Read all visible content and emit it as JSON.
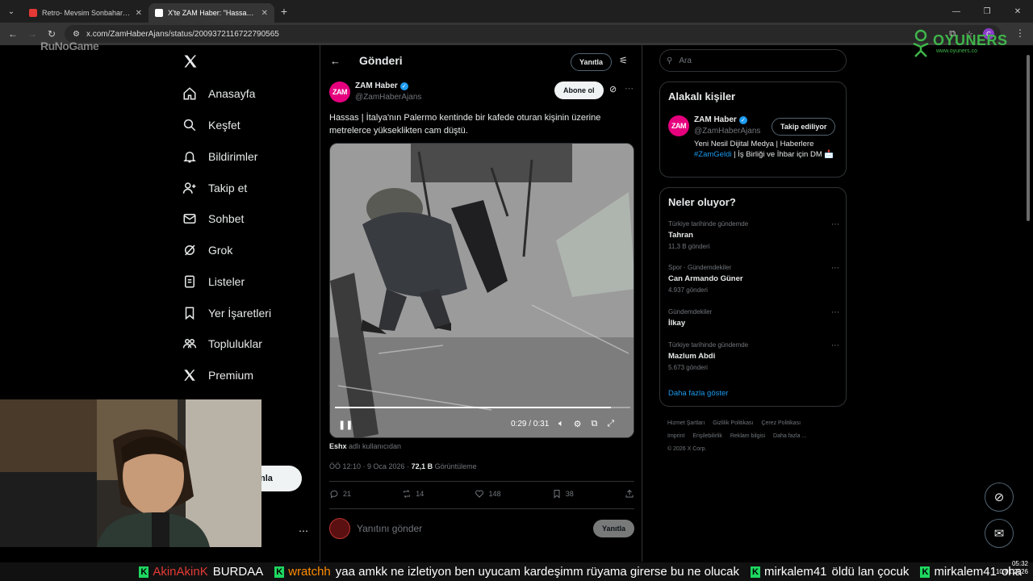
{
  "browser": {
    "tabs": [
      {
        "title": "Retro- Mevsim Sonbahar X MV...",
        "favicon_color": "#e53935",
        "active": false
      },
      {
        "title": "X'te ZAM Haber: \"Hassas | İt...",
        "favicon_color": "#ffffff",
        "active": true
      }
    ],
    "url": "x.com/ZamHaberAjans/status/2009372116722790565",
    "profile_initial": "C"
  },
  "watermarks": {
    "left": "RuNoGame",
    "right_brand": "OYUNERS",
    "right_sub": "www.oyuners.co"
  },
  "sidebar": {
    "items": [
      {
        "label": "Anasayfa",
        "icon": "home-icon"
      },
      {
        "label": "Keşfet",
        "icon": "search-icon"
      },
      {
        "label": "Bildirimler",
        "icon": "bell-icon"
      },
      {
        "label": "Takip et",
        "icon": "person-add-icon"
      },
      {
        "label": "Sohbet",
        "icon": "mail-icon"
      },
      {
        "label": "Grok",
        "icon": "grok-icon"
      },
      {
        "label": "Listeler",
        "icon": "list-icon"
      },
      {
        "label": "Yer İşaretleri",
        "icon": "bookmark-icon"
      },
      {
        "label": "Topluluklar",
        "icon": "communities-icon"
      },
      {
        "label": "Premium",
        "icon": "x-icon"
      }
    ],
    "post_button_partial": "nla"
  },
  "post": {
    "header_title": "Gönderi",
    "header_reply_button": "Yanıtla",
    "author_name": "ZAM Haber",
    "author_handle": "@ZamHaberAjans",
    "avatar_text": "ZAM",
    "follow_button": "Abone ol",
    "text": "Hassas | İtalya'nın Palermo kentinde bir kafede oturan kişinin üzerine metrelerce yükseklikten cam düştü.",
    "video": {
      "time": "0:29 / 0:31",
      "progress": 0.935
    },
    "author_note_user": "Eshx",
    "author_note_suffix": " adlı kullanıcıdan",
    "meta_time": "ÖÖ 12:10 · 9 Oca 2026 · ",
    "meta_views": "72,1 B",
    "meta_views_label": " Görüntüleme",
    "stats": {
      "replies": "21",
      "reposts": "14",
      "likes": "148",
      "bookmarks": "38"
    },
    "reply_placeholder": "Yanıtını gönder",
    "reply_button": "Yanıtla"
  },
  "right": {
    "search_placeholder": "Ara",
    "related_title": "Alakalı kişiler",
    "related": {
      "name": "ZAM Haber",
      "handle": "@ZamHaberAjans",
      "button": "Takip ediliyor",
      "bio_1": "Yeni Nesil Dijital Medya | Haberlere ",
      "bio_tag": "#ZamGeldi",
      "bio_2": " | İş Birliği ve İhbar için DM 📩"
    },
    "trends_title": "Neler oluyor?",
    "trends": [
      {
        "context": "Türkiye tarihinde gündemde",
        "name": "Tahran",
        "count": "11,3 B gönderi"
      },
      {
        "context": "Spor · Gündemdekiler",
        "name": "Can Armando Güner",
        "count": "4.937 gönderi"
      },
      {
        "context": "Gündemdekiler",
        "name": "İlkay",
        "count": ""
      },
      {
        "context": "Türkiye tarihinde gündemde",
        "name": "Mazlum Abdi",
        "count": "5.673 gönderi"
      }
    ],
    "show_more": "Daha fazla göster",
    "footer": [
      "Hizmet Şartları",
      "Gizlilik Politikası",
      "Çerez Politikası",
      "Imprint",
      "Erişilebilirlik",
      "Reklam bilgisi",
      "Daha fazla ...",
      "© 2026 X Corp."
    ]
  },
  "chat": [
    {
      "user": "AkinAkinK",
      "user_color": "#e53935",
      "text": "BURDAA"
    },
    {
      "user": "wratchh",
      "user_color": "#ff8c00",
      "text": "yaa amkk ne izletiyon ben uyucam kardeşimm rüyama girerse bu ne olucak"
    },
    {
      "user": "mirkalem41",
      "user_color": "#ffffff",
      "text": "öldü lan çocuk"
    },
    {
      "user": "mirkalem41",
      "user_color": "#ffffff",
      "text": "oha"
    }
  ],
  "tray": {
    "time": "05:32",
    "date": "10.01.2026"
  },
  "colors": {
    "accent": "#1d9bf0",
    "brand_zam": "#e6007e",
    "kick_green": "#1ed760"
  }
}
